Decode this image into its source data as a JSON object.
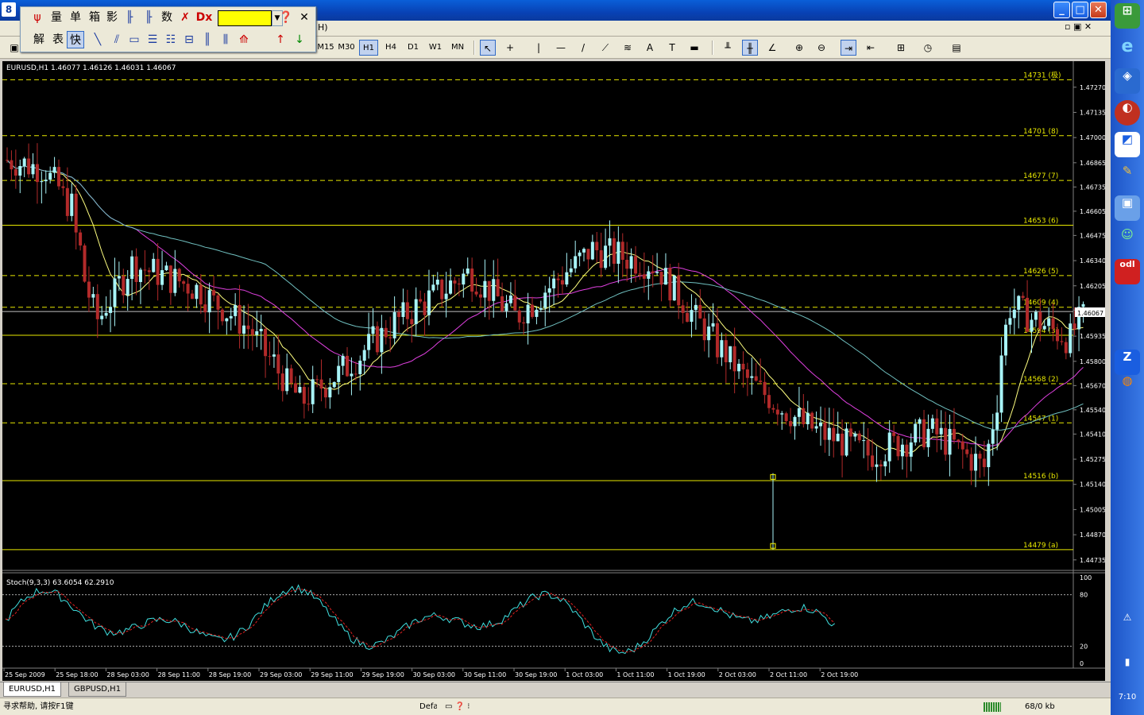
{
  "window": {
    "minimize_label": "_",
    "maximize_label": "□",
    "close_label": "✕",
    "inner_restore": "▫ ▣ ✕",
    "app_letter": "8"
  },
  "menu": {
    "partial_item": "H)"
  },
  "floatbar": {
    "row1": [
      "量",
      "单",
      "箱",
      "影",
      "数"
    ],
    "row2": [
      "解",
      "表",
      "快"
    ],
    "help_icon": "question-icon",
    "close_label": "✕"
  },
  "toolbar": {
    "timeframes": [
      "M15",
      "M30",
      "H1",
      "H4",
      "D1",
      "W1",
      "MN"
    ],
    "active_timeframe": "H1"
  },
  "chart": {
    "header": "EURUSD,H1  1.46077 1.46126 1.46031 1.46067",
    "indicator_header": "Stoch(9,3,3) 63.6054 62.2910",
    "current_price": "1.46067",
    "price_ticks": [
      "1.47270",
      "1.47135",
      "1.47000",
      "1.46865",
      "1.46735",
      "1.46605",
      "1.46475",
      "1.46340",
      "1.46205",
      "1.46075",
      "1.45935",
      "1.45800",
      "1.45670",
      "1.45540",
      "1.45410",
      "1.45275",
      "1.45140",
      "1.45005",
      "1.44870",
      "1.44735"
    ],
    "stoch_ticks": [
      "100",
      "80",
      "20",
      "0"
    ],
    "time_ticks": [
      "25 Sep 2009",
      "25 Sep 18:00",
      "28 Sep 03:00",
      "28 Sep 11:00",
      "28 Sep 19:00",
      "29 Sep 03:00",
      "29 Sep 11:00",
      "29 Sep 19:00",
      "30 Sep 03:00",
      "30 Sep 11:00",
      "30 Sep 19:00",
      "1 Oct 03:00",
      "1 Oct 11:00",
      "1 Oct 19:00",
      "2 Oct 03:00",
      "2 Oct 11:00",
      "2 Oct 19:00"
    ],
    "fib_labels": [
      "14731 (极)",
      "14701 (8)",
      "14677 (7)",
      "14653 (6)",
      "14626 (5)",
      "14609 (4)",
      "14594 (3)",
      "14568 (2)",
      "14547 (1)",
      "14516 (b)",
      "14479 (a)"
    ],
    "colors": {
      "bg": "#000000",
      "bull": "#a8f4f8",
      "bear": "#b22a2a",
      "fib": "#e8e800",
      "ma_fast": "#ffff80",
      "ma_mid": "#e040e0",
      "ma_slow": "#70c0c0"
    }
  },
  "chart_data": {
    "type": "candlestick",
    "symbol": "EURUSD",
    "timeframe": "H1",
    "ylim": [
      1.447,
      1.4735
    ],
    "fib_levels": [
      1.4731,
      1.4701,
      1.4677,
      1.4653,
      1.4626,
      1.4609,
      1.4594,
      1.4568,
      1.4547,
      1.4516,
      1.4479
    ],
    "last_close": 1.46067,
    "stoch": {
      "k": 63.6054,
      "d": 62.291,
      "levels": [
        80,
        20
      ]
    }
  },
  "tabs": [
    "EURUSD,H1",
    "GBPUSD,H1"
  ],
  "status": {
    "help": "寻求帮助, 请按F1键",
    "profile": "Default",
    "traffic": "68/0 kb"
  },
  "sidebar": {
    "clock": "7:10"
  }
}
